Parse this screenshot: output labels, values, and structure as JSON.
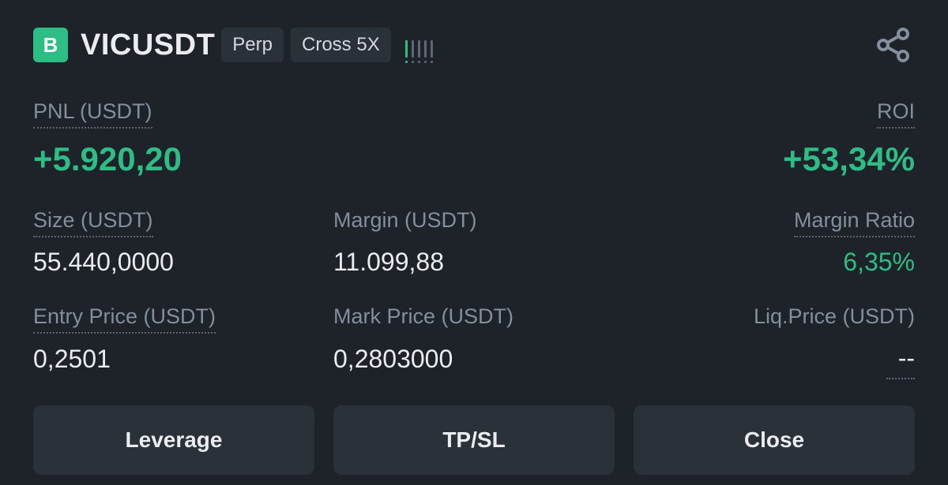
{
  "header": {
    "side_badge": "B",
    "symbol": "VICUSDT",
    "tags": [
      "Perp",
      "Cross 5X"
    ],
    "risk_level": 1,
    "risk_level_max": 5,
    "icons": [
      "risk-bars-icon",
      "share-icon"
    ]
  },
  "pnl": {
    "label": "PNL (USDT)",
    "value": "+5.920,20"
  },
  "roi": {
    "label": "ROI",
    "value": "+53,34%"
  },
  "size": {
    "label": "Size (USDT)",
    "value": "55.440,0000"
  },
  "margin": {
    "label": "Margin (USDT)",
    "value": "11.099,88"
  },
  "margin_ratio": {
    "label": "Margin Ratio",
    "value": "6,35%"
  },
  "entry_price": {
    "label": "Entry Price (USDT)",
    "value": "0,2501"
  },
  "mark_price": {
    "label": "Mark Price (USDT)",
    "value": "0,2803000"
  },
  "liq_price": {
    "label": "Liq.Price (USDT)",
    "value": "--"
  },
  "buttons": {
    "leverage": "Leverage",
    "tpsl": "TP/SL",
    "close": "Close"
  },
  "colors": {
    "background": "#1e2229",
    "positive": "#2ebd85",
    "button_bg": "#2b3139",
    "label": "#848e9c"
  }
}
